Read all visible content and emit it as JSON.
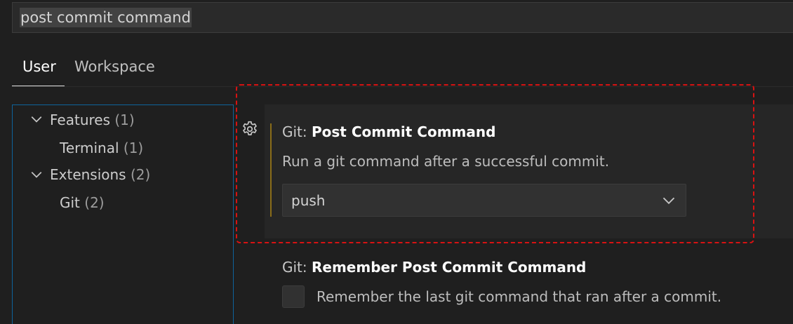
{
  "search": {
    "value": "post commit command"
  },
  "tabs": [
    {
      "label": "User",
      "active": true
    },
    {
      "label": "Workspace",
      "active": false
    }
  ],
  "tree": {
    "items": [
      {
        "label": "Features",
        "count": "(1)",
        "expanded": true
      },
      {
        "label": "Terminal",
        "count": "(1)"
      },
      {
        "label": "Extensions",
        "count": "(2)",
        "expanded": true
      },
      {
        "label": "Git",
        "count": "(2)"
      }
    ]
  },
  "settings": [
    {
      "category": "Git: ",
      "name": "Post Commit Command",
      "description": "Run a git command after a successful commit.",
      "value": "push",
      "control": "dropdown",
      "icon": "gear-icon"
    },
    {
      "category": "Git: ",
      "name": "Remember Post Commit Command",
      "description": "Remember the last git command that ran after a commit.",
      "checked": false,
      "control": "checkbox"
    }
  ],
  "colors": {
    "background": "#1f1f1f",
    "focused_row": "#262626",
    "modified_bar": "#8a6d19",
    "highlight_outline": "#d81212",
    "tree_border": "#0e639c"
  }
}
